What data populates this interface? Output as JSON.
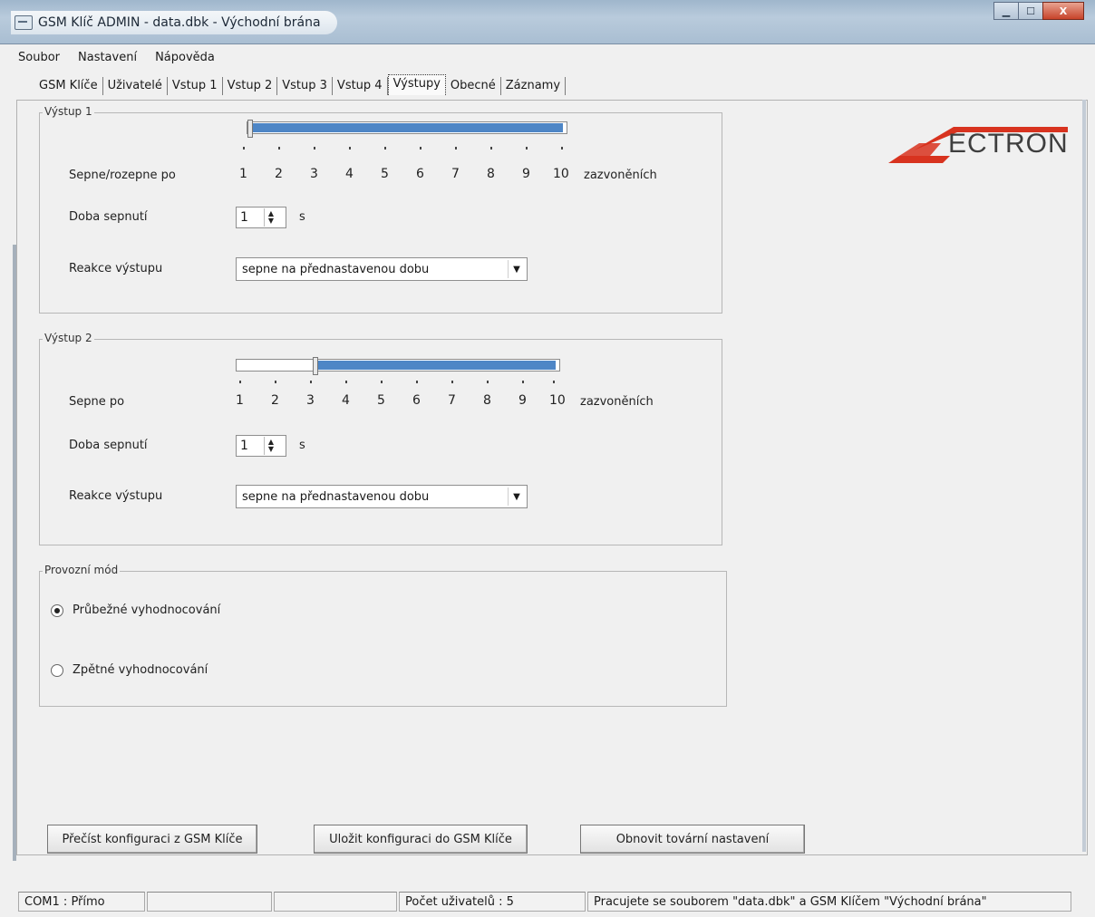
{
  "window": {
    "title": "GSM Klíč ADMIN - data.dbk - Východní brána",
    "buttons": {
      "minimize": "▁",
      "maximize": "☐",
      "close": "X"
    }
  },
  "menu": [
    {
      "label": "Soubor"
    },
    {
      "label": "Nastavení"
    },
    {
      "label": "Nápověda"
    }
  ],
  "tabs": [
    "GSM Klíče",
    "Uživatelé",
    "Vstup 1",
    "Vstup 2",
    "Vstup 3",
    "Vstup 4",
    "Výstupy",
    "Obecné",
    "Záznamy"
  ],
  "active_tab": "Výstupy",
  "logo": {
    "text": "ECTRON",
    "colors": {
      "red": "#d8331f",
      "gray": "#3e3e3e"
    }
  },
  "output1": {
    "legend": "Výstup 1",
    "slider_label": "Sepne/rozepne po",
    "scale": [
      "1",
      "2",
      "3",
      "4",
      "5",
      "6",
      "7",
      "8",
      "9",
      "10"
    ],
    "unit": "zazvoněních",
    "slider_value": 1,
    "duration_label": "Doba sepnutí",
    "duration_value": "1",
    "duration_unit": "s",
    "reaction_label": "Reakce výstupu",
    "reaction_value": "sepne na přednastavenou dobu"
  },
  "output2": {
    "legend": "Výstup 2",
    "slider_label": "Sepne po",
    "scale": [
      "1",
      "2",
      "3",
      "4",
      "5",
      "6",
      "7",
      "8",
      "9",
      "10"
    ],
    "unit": "zazvoněních",
    "slider_value": 3,
    "duration_label": "Doba sepnutí",
    "duration_value": "1",
    "duration_unit": "s",
    "reaction_label": "Reakce výstupu",
    "reaction_value": "sepne na přednastavenou dobu"
  },
  "mode": {
    "legend": "Provozní mód",
    "options": [
      {
        "label": "Průbežné vyhodnocování",
        "checked": true
      },
      {
        "label": "Zpětné vyhodnocování",
        "checked": false
      }
    ]
  },
  "buttons": {
    "read": "Přečíst konfiguraci z GSM Klíče",
    "save": "Uložit konfiguraci do GSM Klíče",
    "reset": "Obnovit tovární nastavení"
  },
  "status": {
    "port": "COM1 : Přímo",
    "empty1": "",
    "empty2": "",
    "users": "Počet uživatelů : 5",
    "message": "Pracujete se souborem \"data.dbk\" a GSM Klíčem \"Východní brána\""
  },
  "colors": {
    "slider_fill": "#4e86c6",
    "titlebar": "#a9bed2",
    "close_button": "#c7432a"
  }
}
